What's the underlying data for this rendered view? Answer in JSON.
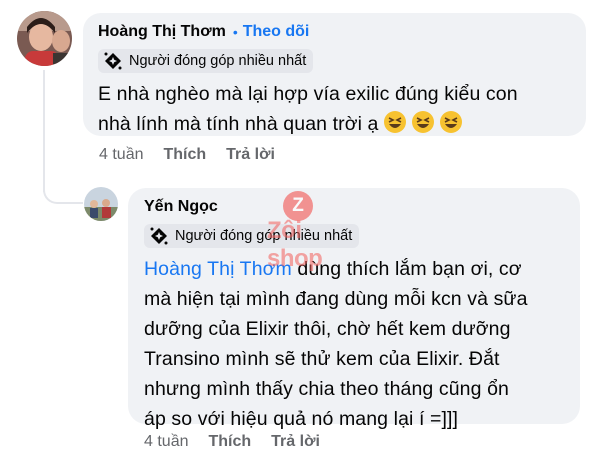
{
  "comments": [
    {
      "author": "Hoàng Thị Thơm",
      "separator": "•",
      "follow_label": "Theo dõi",
      "badge": "Người đóng góp nhiều nhất",
      "text_line1": "E nhà nghèo mà lại hợp vía exilic đúng kiểu con",
      "text_line2": "nhà lính mà tính nhà quan trời ạ",
      "emoji": [
        "grinning-squinting-face",
        "grinning-squinting-face",
        "grinning-squinting-face"
      ],
      "time": "4 tuần",
      "like_label": "Thích",
      "reply_label": "Trả lời"
    },
    {
      "author": "Yến Ngọc",
      "badge": "Người đóng góp nhiều nhất",
      "mention": "Hoàng Thị Thơm",
      "text_line1_rest": " dùng thích lắm bạn ơi, cơ",
      "text_line2": "mà hiện tại mình đang dùng mỗi kcn và sữa",
      "text_line3": "dưỡng của Elixir thôi, chờ hết kem dưỡng",
      "text_line4": "Transino mình sẽ thử kem của Elixir. Đắt",
      "text_line5": "nhưng mình thấy chia theo tháng cũng ổn",
      "text_line6": "áp so với hiệu quả nó mang lại í =]]]",
      "time": "4 tuần",
      "like_label": "Thích",
      "reply_label": "Trả lời"
    }
  ],
  "watermark": {
    "letter": "Z",
    "text": "Zôi shop"
  },
  "colors": {
    "link": "#1877f2",
    "bubble": "#f0f2f5",
    "meta": "#65676b",
    "badge": "#e4e6eb",
    "watermark": "#f25f5c"
  }
}
